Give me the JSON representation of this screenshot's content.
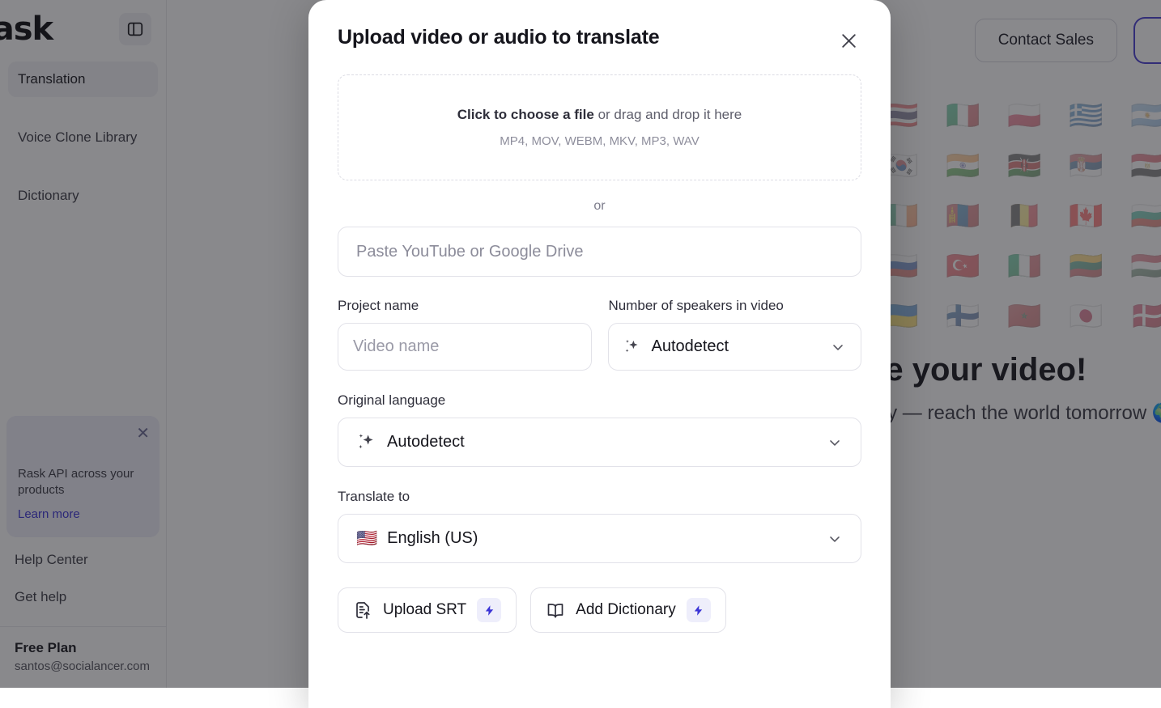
{
  "sidebar": {
    "logo": "rask",
    "panel_toggle_icon": "sidebar-toggle-icon",
    "nav": [
      {
        "label": "Translation",
        "active": true
      },
      {
        "label": "Voice Clone Library",
        "active": false
      },
      {
        "label": "Dictionary",
        "active": false
      }
    ],
    "promo": {
      "close_icon": "close-icon",
      "body": "Rask API across your products",
      "link": "Learn more"
    },
    "links": [
      {
        "label": "Help Center"
      },
      {
        "label": "Get help"
      }
    ],
    "account": {
      "plan": "Free Plan",
      "email": "santos@socialancer.com"
    }
  },
  "topbar": {
    "contact_sales_label": "Contact Sales",
    "primary_button_label": ""
  },
  "background": {
    "flags": [
      "🇹🇭",
      "🇮🇹",
      "🇵🇱",
      "🇬🇷",
      "🇦🇷",
      "🇰🇷",
      "🇮🇳",
      "🇰🇪",
      "🇷🇸",
      "🇪🇬",
      "🇮🇪",
      "🇲🇳",
      "🇧🇪",
      "🇨🇦",
      "🇧🇬",
      "🇷🇺",
      "🇹🇷",
      "🇮🇹",
      "🇱🇹",
      "🇭🇺",
      "🇺🇦",
      "🇫🇮",
      "🇲🇦",
      "🇯🇵",
      "🇩🇰"
    ],
    "hero_line1": "Translate your video!",
    "hero_line2": "Go global today — reach the world tomorrow 🌍"
  },
  "modal": {
    "title": "Upload video or audio to translate",
    "close_icon": "close-icon",
    "dropzone": {
      "link_text": "Click to choose a file",
      "rest_text": " or drag and drop it here",
      "formats": "MP4, MOV, WEBM, MKV, MP3, WAV"
    },
    "or_label": "or",
    "url_input": {
      "placeholder": "Paste YouTube or Google Drive",
      "value": ""
    },
    "project_name": {
      "label": "Project name",
      "placeholder": "Video name",
      "value": ""
    },
    "speakers": {
      "label": "Number of speakers in video",
      "value": "Autodetect",
      "icon": "sparkle-icon",
      "chevron": "chevron-down-icon"
    },
    "original_language": {
      "label": "Original language",
      "value": "Autodetect",
      "icon": "sparkle-icon",
      "chevron": "chevron-down-icon"
    },
    "translate_to": {
      "label": "Translate to",
      "value": "English (US)",
      "flag": "🇺🇸",
      "chevron": "chevron-down-icon"
    },
    "actions": [
      {
        "label": "Upload SRT",
        "icon": "document-upload-icon",
        "badge": "bolt-icon"
      },
      {
        "label": "Add Dictionary",
        "icon": "book-icon",
        "badge": "bolt-icon"
      }
    ]
  },
  "colors": {
    "accent": "#3b34d6",
    "badge_bg": "#eeeefb",
    "overlay": "rgba(28,28,34,0.52)"
  }
}
